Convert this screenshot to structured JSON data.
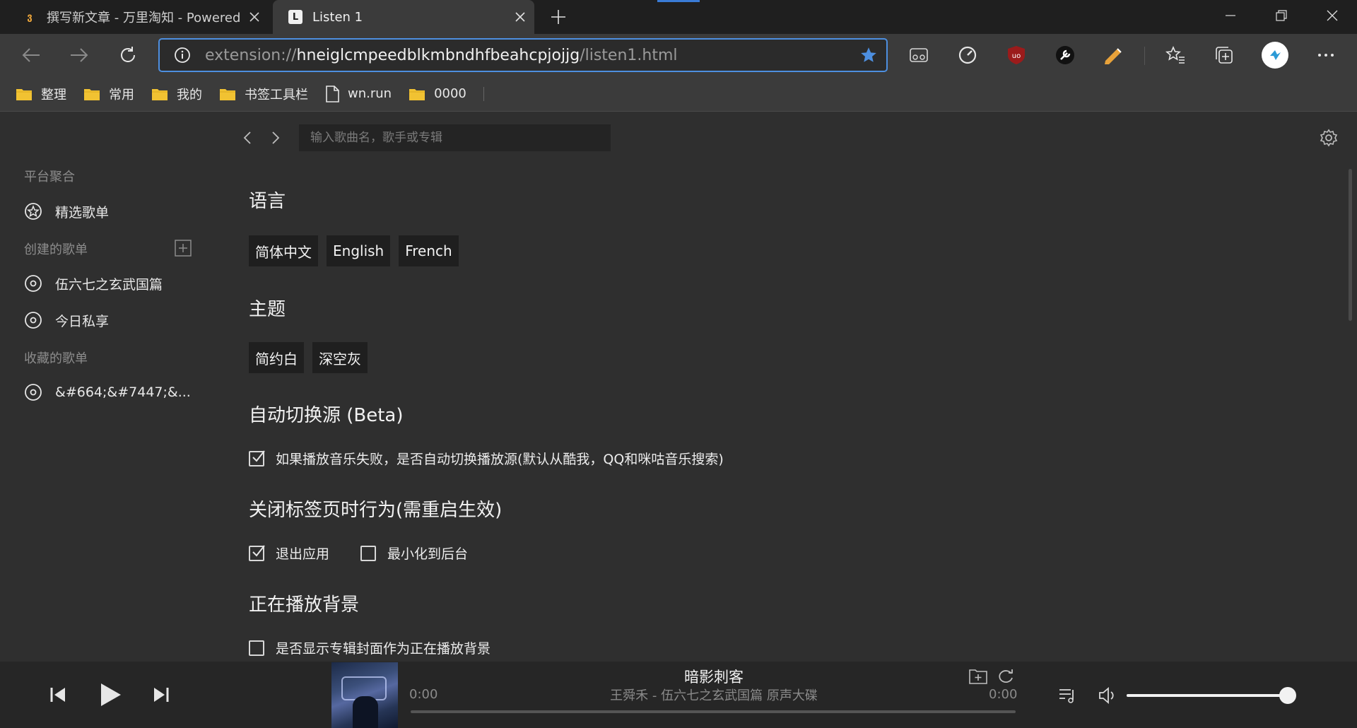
{
  "browser": {
    "tabs": [
      {
        "favicon": "ვ",
        "title": "撰写新文章 - 万里淘知 - Powered"
      },
      {
        "favicon": "L",
        "title": "Listen 1"
      }
    ],
    "url_prefix": "extension://",
    "url_host": "hneiglcmpeedblkmbndhfbeahcpjojjg",
    "url_path": "/listen1.html",
    "bookmarks": [
      {
        "icon": "folder-icon",
        "label": "整理"
      },
      {
        "icon": "folder-icon",
        "label": "常用"
      },
      {
        "icon": "folder-icon",
        "label": "我的"
      },
      {
        "icon": "folder-icon",
        "label": "书签工具栏"
      },
      {
        "icon": "page-icon",
        "label": "wn.run"
      },
      {
        "icon": "folder-icon",
        "label": "0000"
      }
    ],
    "accent_color": "#4d8fe0"
  },
  "app": {
    "search_placeholder": "输入歌曲名，歌手或专辑",
    "sidebar": {
      "platform_section": "平台聚合",
      "featured_playlists": "精选歌单",
      "created_section": "创建的歌单",
      "created": [
        "伍六七之玄武国篇",
        "今日私享"
      ],
      "favorite_section": "收藏的歌单",
      "favorites": [
        "&#664;&#7447;&..."
      ]
    },
    "settings": {
      "language": {
        "heading": "语言",
        "options": [
          "简体中文",
          "English",
          "French"
        ]
      },
      "theme": {
        "heading": "主题",
        "options": [
          "简约白",
          "深空灰"
        ]
      },
      "auto_switch": {
        "heading": "自动切换源 (Beta)",
        "checkbox_label": "如果播放音乐失败，是否自动切换播放源(默认从酷我，QQ和咪咕音乐搜索)",
        "checked": true
      },
      "close_behavior": {
        "heading": "关闭标签页时行为(需重启生效)",
        "option_quit": "退出应用",
        "option_quit_checked": true,
        "option_minimize": "最小化到后台",
        "option_minimize_checked": false
      },
      "now_playing_bg": {
        "heading": "正在播放背景",
        "checkbox_label": "是否显示专辑封面作为正在播放背景",
        "checked": false
      }
    }
  },
  "player": {
    "title": "暗影刺客",
    "subtitle": "王舜禾 - 伍六七之玄武国篇 原声大碟",
    "current_time": "0:00",
    "duration": "0:00",
    "progress_fraction": 0.0,
    "volume_fraction": 1.0
  }
}
